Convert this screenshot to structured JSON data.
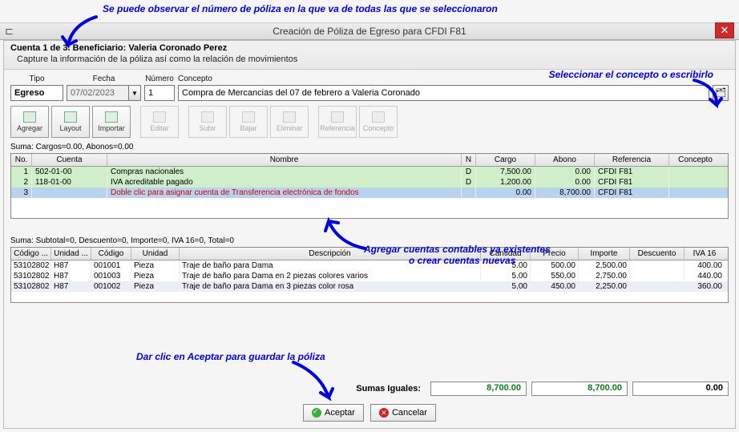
{
  "annotations": {
    "top": "Se puede observar el número de póliza en la que va de todas las que se seleccionaron",
    "right": "Seleccionar el concepto o escribirlo",
    "mid1": "Agregar cuentas contables ya existentes",
    "mid2": "o crear cuentas nuevas",
    "bottom": "Dar clic en Aceptar para guardar la póliza"
  },
  "window": {
    "title": "Creación de Póliza de Egreso para CFDI F81",
    "close": "✕",
    "back": "⊏"
  },
  "subheader": {
    "line1": "Cuenta 1 de 3. Beneficiario: Valeria Coronado Perez",
    "line2": "Capture la información de la póliza así como la relación de movimientos"
  },
  "form": {
    "type_label": "Tipo",
    "type_value": "Egreso",
    "date_label": "Fecha",
    "date_value": "07/02/2023",
    "num_label": "Número",
    "num_value": "1",
    "concept_label": "Concepto",
    "concept_value": "Compra de Mercancias del 07 de febrero a Valeria Coronado"
  },
  "toolbar": {
    "agregar": "Agregar",
    "layout": "Layout",
    "importar": "Importar",
    "editar": "Editar",
    "subir": "Subir",
    "bajar": "Bajar",
    "eliminar": "Eliminar",
    "referencia": "Referencia",
    "concepto": "Concepto"
  },
  "summary1": "Suma:  Cargos=0.00, Abonos=0.00",
  "grid1": {
    "headers": {
      "no": "No.",
      "cuenta": "Cuenta",
      "nombre": "Nombre",
      "n": "N",
      "cargo": "Cargo",
      "abono": "Abono",
      "ref": "Referencia",
      "con": "Concepto"
    },
    "rows": [
      {
        "no": "1",
        "cuenta": "502-01-00",
        "nombre": "Compras nacionales",
        "n": "D",
        "cargo": "7,500.00",
        "abono": "0.00",
        "ref": "CFDI F81",
        "con": ""
      },
      {
        "no": "2",
        "cuenta": "118-01-00",
        "nombre": "IVA acreditable pagado",
        "n": "D",
        "cargo": "1,200.00",
        "abono": "0.00",
        "ref": "CFDI F81",
        "con": ""
      },
      {
        "no": "3",
        "cuenta": "",
        "nombre": "Doble clic para asignar cuenta de Transferencia electrónica de fondos",
        "n": "",
        "cargo": "0.00",
        "abono": "8,700.00",
        "ref": "CFDI F81",
        "con": ""
      }
    ]
  },
  "summary2": "Suma:  Subtotal=0, Descuento=0, Importe=0, IVA 16=0, Total=0",
  "grid2": {
    "headers": {
      "d1": "Código ...",
      "d2": "Unidad ...",
      "d3": "Código",
      "d4": "Unidad",
      "d5": "Descripción",
      "d6": "Cantidad",
      "d7": "Precio",
      "d8": "Importe",
      "d9": "Descuento",
      "d10": "IVA 16"
    },
    "rows": [
      {
        "d1": "53102802",
        "d2": "H87",
        "d3": "001001",
        "d4": "Pieza",
        "d5": "Traje de baño para Dama",
        "d6": "5.00",
        "d7": "500.00",
        "d8": "2,500.00",
        "d9": "",
        "d10": "400.00"
      },
      {
        "d1": "53102802",
        "d2": "H87",
        "d3": "001003",
        "d4": "Pieza",
        "d5": "Traje de baño para Dama en 2 piezas colores varios",
        "d6": "5.00",
        "d7": "550.00",
        "d8": "2,750.00",
        "d9": "",
        "d10": "440.00"
      },
      {
        "d1": "53102802",
        "d2": "H87",
        "d3": "001002",
        "d4": "Pieza",
        "d5": "Traje de baño para Dama en 3 piezas color rosa",
        "d6": "5.00",
        "d7": "450.00",
        "d8": "2,250.00",
        "d9": "",
        "d10": "360.00"
      }
    ]
  },
  "totals": {
    "label": "Sumas Iguales:",
    "a": "8,700.00",
    "b": "8,700.00",
    "c": "0.00"
  },
  "buttons": {
    "ok": "Aceptar",
    "cancel": "Cancelar"
  }
}
